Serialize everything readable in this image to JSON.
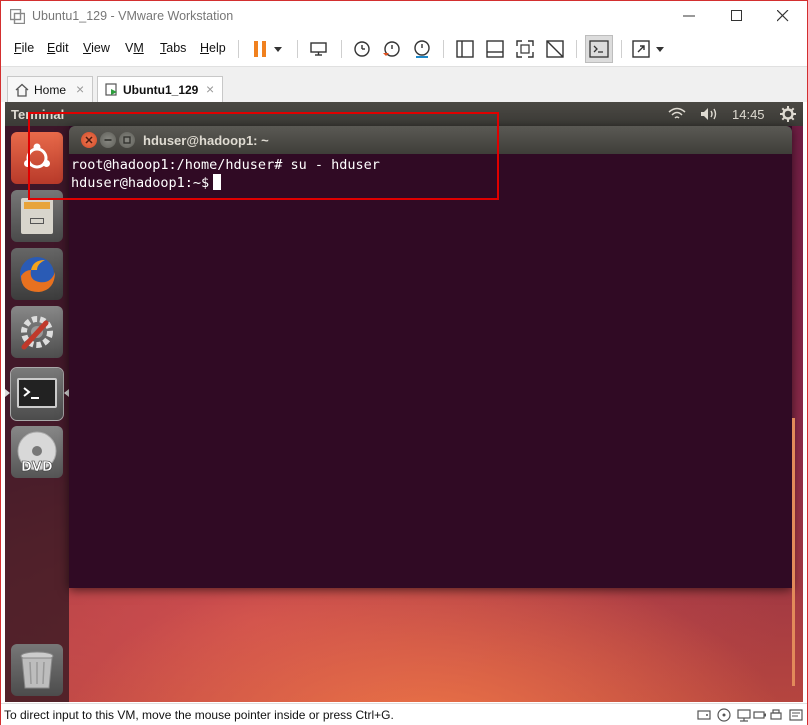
{
  "window": {
    "title": "Ubuntu1_129 - VMware Workstation"
  },
  "menubar": {
    "items": [
      {
        "label": "File",
        "key": "F"
      },
      {
        "label": "Edit",
        "key": "E"
      },
      {
        "label": "View",
        "key": "V"
      },
      {
        "label": "VM",
        "key": "M"
      },
      {
        "label": "Tabs",
        "key": "T"
      },
      {
        "label": "Help",
        "key": "H"
      }
    ]
  },
  "tabs": [
    {
      "label": "Home",
      "icon": "home-icon"
    },
    {
      "label": "Ubuntu1_129",
      "icon": "vm-icon",
      "active": true
    }
  ],
  "ubuntu": {
    "panel_title": "Terminal",
    "clock": "14:45",
    "launcher": [
      "ubuntu-dash-icon",
      "files-icon",
      "firefox-icon",
      "system-settings-icon",
      "terminal-icon",
      "dvd-icon",
      "trash-icon"
    ]
  },
  "terminal": {
    "title": "hduser@hadoop1: ~",
    "lines": [
      "root@hadoop1:/home/hduser# su - hduser",
      "hduser@hadoop1:~$"
    ]
  },
  "statusbar": {
    "text": "To direct input to this VM, move the mouse pointer inside or press Ctrl+G."
  },
  "colors": {
    "terminal_bg": "#300a24",
    "annotation": "#e00000",
    "pause_orange": "#f0801e"
  }
}
